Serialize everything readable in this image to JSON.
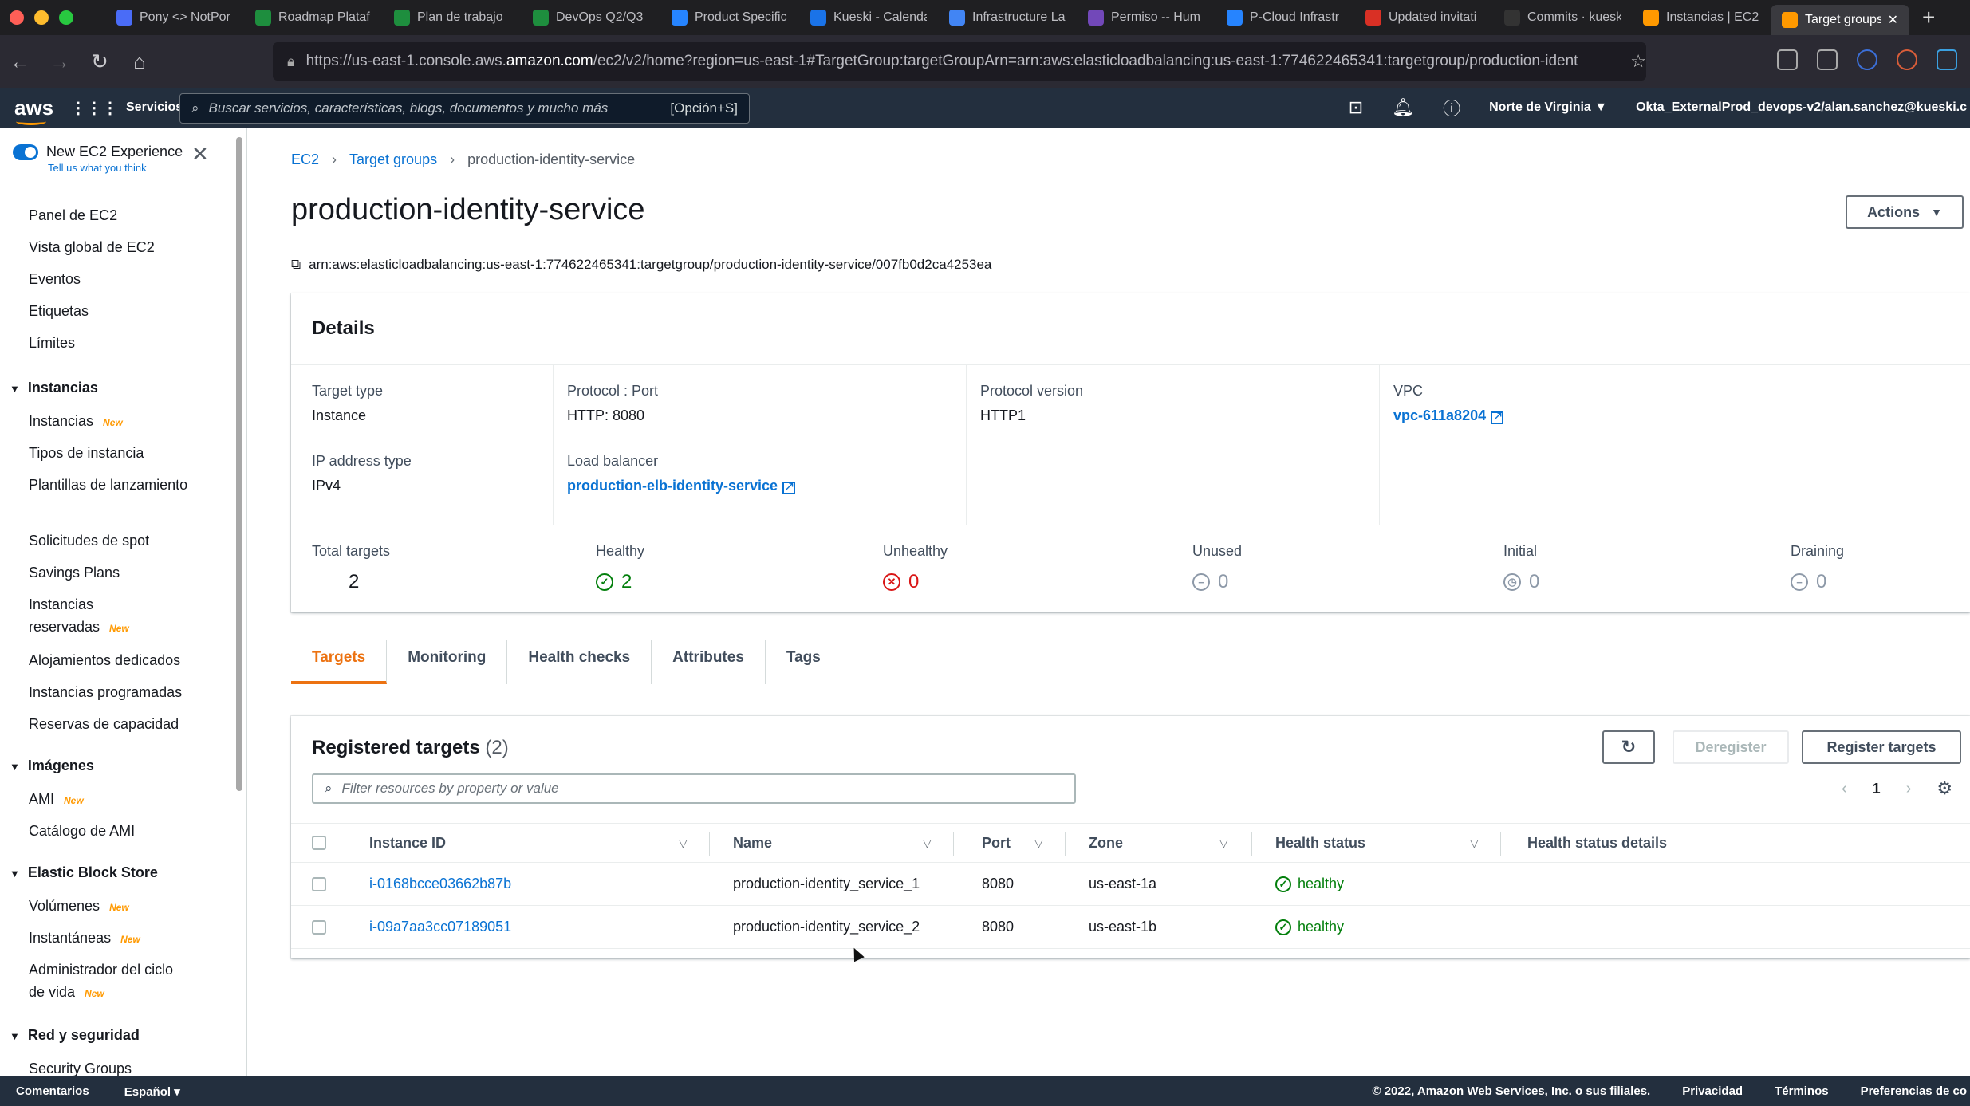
{
  "browser": {
    "tabs": [
      {
        "title": "Pony <> NotPor",
        "icon": "notion-icon",
        "color": "#4a6cf7"
      },
      {
        "title": "Roadmap Plataf",
        "icon": "sheets-icon",
        "color": "#1e8e3e"
      },
      {
        "title": "Plan de trabajo",
        "icon": "sheets-icon",
        "color": "#1e8e3e"
      },
      {
        "title": "DevOps Q2/Q3",
        "icon": "sheets-icon",
        "color": "#1e8e3e"
      },
      {
        "title": "Product Specific",
        "icon": "jira-icon",
        "color": "#2684ff"
      },
      {
        "title": "Kueski - Calenda",
        "icon": "calendar-icon",
        "color": "#1a73e8"
      },
      {
        "title": "Infrastructure La",
        "icon": "docs-icon",
        "color": "#4285f4"
      },
      {
        "title": "Permiso -- Hum",
        "icon": "form-icon",
        "color": "#7248b9"
      },
      {
        "title": "P-Cloud Infrastr",
        "icon": "jira-icon",
        "color": "#2684ff"
      },
      {
        "title": "Updated invitati",
        "icon": "gmail-icon",
        "color": "#d93025"
      },
      {
        "title": "Commits · kuesk",
        "icon": "github-icon",
        "color": "#333333"
      },
      {
        "title": "Instancias | EC2",
        "icon": "ec2-icon",
        "color": "#ff9900"
      },
      {
        "title": "Target groups",
        "icon": "ec2-icon",
        "color": "#ff9900"
      }
    ],
    "url_prefix": "https://us-east-1.console.aws.",
    "url_domain": "amazon.com",
    "url_rest": "/ec2/v2/home?region=us-east-1#TargetGroup:targetGroupArn=arn:aws:elasticloadbalancing:us-east-1:774622465341:targetgroup/production-ident"
  },
  "aws_header": {
    "logo": "aws",
    "services": "Servicios",
    "search_placeholder": "Buscar servicios, características, blogs, documentos y mucho más",
    "search_shortcut": "[Opción+S]",
    "region": "Norte de Virginia ▼",
    "account": "Okta_ExternalProd_devops-v2/alan.sanchez@kueski.c"
  },
  "sidebar": {
    "new_experience": "New EC2 Experience",
    "tell_us": "Tell us what you think",
    "top_items": [
      "Panel de EC2",
      "Vista global de EC2",
      "Eventos",
      "Etiquetas",
      "Límites"
    ],
    "sections": [
      {
        "title": "Instancias",
        "items": [
          {
            "label": "Instancias",
            "new": "New"
          },
          {
            "label": "Tipos de instancia",
            "new": ""
          },
          {
            "label": "Plantillas de lanzamiento",
            "new": ""
          },
          {
            "label": "Solicitudes de spot",
            "new": ""
          },
          {
            "label": "Savings Plans",
            "new": ""
          },
          {
            "label": "Instancias reservadas",
            "new": "New"
          },
          {
            "label": "Alojamientos dedicados",
            "new": ""
          },
          {
            "label": "Instancias programadas",
            "new": ""
          },
          {
            "label": "Reservas de capacidad",
            "new": ""
          }
        ]
      },
      {
        "title": "Imágenes",
        "items": [
          {
            "label": "AMI",
            "new": "New"
          },
          {
            "label": "Catálogo de AMI",
            "new": ""
          }
        ]
      },
      {
        "title": "Elastic Block Store",
        "items": [
          {
            "label": "Volúmenes",
            "new": "New"
          },
          {
            "label": "Instantáneas",
            "new": "New"
          },
          {
            "label": "Administrador del ciclo de vida",
            "new": "New"
          }
        ]
      },
      {
        "title": "Red y seguridad",
        "items": [
          {
            "label": "Security Groups",
            "new": ""
          }
        ]
      }
    ]
  },
  "breadcrumb": [
    "EC2",
    "Target groups",
    "production-identity-service"
  ],
  "page": {
    "title": "production-identity-service",
    "actions": "Actions",
    "arn": "arn:aws:elasticloadbalancing:us-east-1:774622465341:targetgroup/production-identity-service/007fb0d2ca4253ea"
  },
  "details": {
    "heading": "Details",
    "target_type_label": "Target type",
    "target_type": "Instance",
    "ip_type_label": "IP address type",
    "ip_type": "IPv4",
    "protocol_label": "Protocol : Port",
    "protocol": "HTTP: 8080",
    "lb_label": "Load balancer",
    "lb": "production-elb-identity-service",
    "pv_label": "Protocol version",
    "pv": "HTTP1",
    "vpc_label": "VPC",
    "vpc": "vpc-611a8204"
  },
  "stats": [
    {
      "label": "Total targets",
      "value": "2",
      "icon": "",
      "color": "#16191f"
    },
    {
      "label": "Healthy",
      "value": "2",
      "icon": "check-circle-icon",
      "color": "#037f0c"
    },
    {
      "label": "Unhealthy",
      "value": "0",
      "icon": "x-circle-icon",
      "color": "#d91515"
    },
    {
      "label": "Unused",
      "value": "0",
      "icon": "minus-circle-icon",
      "color": "#8d99a8"
    },
    {
      "label": "Initial",
      "value": "0",
      "icon": "clock-icon",
      "color": "#8d99a8"
    },
    {
      "label": "Draining",
      "value": "0",
      "icon": "minus-circle-icon",
      "color": "#8d99a8"
    }
  ],
  "tabs": [
    "Targets",
    "Monitoring",
    "Health checks",
    "Attributes",
    "Tags"
  ],
  "targets": {
    "heading": "Registered targets",
    "count": "(2)",
    "deregister": "Deregister",
    "register": "Register targets",
    "filter_placeholder": "Filter resources by property or value",
    "page": "1",
    "columns": [
      "Instance ID",
      "Name",
      "Port",
      "Zone",
      "Health status",
      "Health status details"
    ],
    "rows": [
      {
        "id": "i-0168bcce03662b87b",
        "name": "production-identity_service_1",
        "port": "8080",
        "zone": "us-east-1a",
        "health": "healthy",
        "details": ""
      },
      {
        "id": "i-09a7aa3cc07189051",
        "name": "production-identity_service_2",
        "port": "8080",
        "zone": "us-east-1b",
        "health": "healthy",
        "details": ""
      }
    ]
  },
  "footer": {
    "feedback": "Comentarios",
    "language": "Español",
    "copyright": "© 2022, Amazon Web Services, Inc. o sus filiales.",
    "privacy": "Privacidad",
    "terms": "Términos",
    "cookies": "Preferencias de co"
  }
}
